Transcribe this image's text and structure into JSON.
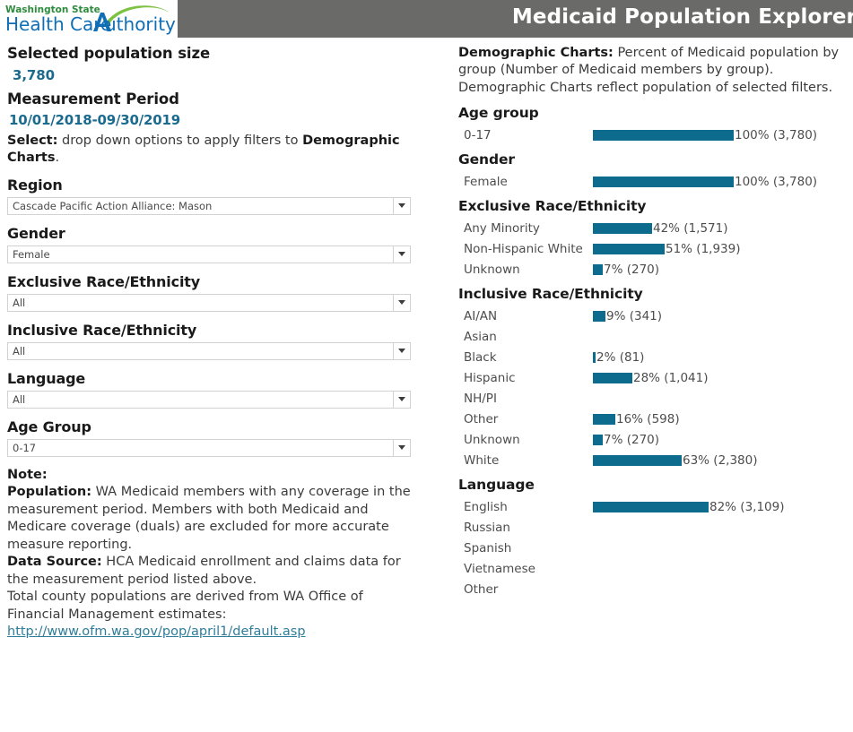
{
  "header": {
    "logo": {
      "line1": "Washington State",
      "line2a": "Health Care ",
      "line2b": "Authority",
      "blue": "#0f6eb5",
      "green": "#7dc242"
    },
    "title": "Medicaid Population Explorer",
    "bar_color": "#6a6a68"
  },
  "left": {
    "population_label": "Selected population size",
    "population_value": "3,780",
    "period_label": "Measurement Period",
    "period_value": "10/01/2018-09/30/2019",
    "select_note_bold1": "Select:",
    "select_note_mid": " drop down options to apply filters to ",
    "select_note_bold2": "Demographic Charts",
    "select_note_end": ".",
    "filters": [
      {
        "label": "Region",
        "value": "Cascade Pacific Action Alliance: Mason",
        "icon": "chevron-down-icon"
      },
      {
        "label": "Gender",
        "value": "Female",
        "icon": "chevron-down-icon"
      },
      {
        "label": "Exclusive Race/Ethnicity",
        "value": "All",
        "icon": "chevron-down-icon"
      },
      {
        "label": "Inclusive Race/Ethnicity",
        "value": "All",
        "icon": "chevron-down-icon"
      },
      {
        "label": "Language",
        "value": "All",
        "icon": "chevron-down-icon"
      },
      {
        "label": "Age Group",
        "value": "0-17",
        "icon": "chevron-down-icon"
      }
    ],
    "note": {
      "heading": "Note:",
      "population_bold": "Population:",
      "population_text": " WA Medicaid members with any coverage in the measurement period. Members with both Medicaid and Medicare coverage (duals) are excluded for more accurate measure reporting.",
      "source_bold": "Data Source:",
      "source_text": " HCA Medicaid enrollment and claims data for the measurement period listed above.",
      "ofm_text": "Total county populations are derived from WA Office of Financial Management estimates:",
      "link": "http://www.ofm.wa.gov/pop/april1/default.asp",
      "link_color": "#2e7d9a"
    }
  },
  "right": {
    "desc_bold": "Demographic Charts:",
    "desc_text": " Percent of Medicaid population by group (Number of Medicaid members by group).",
    "desc_line2": "Demographic Charts reflect population of selected filters."
  },
  "chart_data": [
    {
      "type": "bar",
      "title": "Age group",
      "orientation": "horizontal",
      "xlabel": "Percent of Medicaid population",
      "ylabel": "",
      "xlim": [
        0,
        100
      ],
      "grid": false,
      "legend": null,
      "bar_color": "#0d6c8e",
      "categories": [
        "0-17"
      ],
      "values": [
        100
      ],
      "counts": [
        3780
      ],
      "labels": [
        "100% (3,780)"
      ]
    },
    {
      "type": "bar",
      "title": "Gender",
      "orientation": "horizontal",
      "xlabel": "Percent of Medicaid population",
      "ylabel": "",
      "xlim": [
        0,
        100
      ],
      "grid": false,
      "legend": null,
      "bar_color": "#0d6c8e",
      "categories": [
        "Female"
      ],
      "values": [
        100
      ],
      "counts": [
        3780
      ],
      "labels": [
        "100% (3,780)"
      ]
    },
    {
      "type": "bar",
      "title": "Exclusive Race/Ethnicity",
      "orientation": "horizontal",
      "xlabel": "Percent of Medicaid population",
      "ylabel": "",
      "xlim": [
        0,
        100
      ],
      "grid": false,
      "legend": null,
      "bar_color": "#0d6c8e",
      "categories": [
        "Any Minority",
        "Non-Hispanic White",
        "Unknown"
      ],
      "values": [
        42,
        51,
        7
      ],
      "counts": [
        1571,
        1939,
        270
      ],
      "labels": [
        "42% (1,571)",
        "51% (1,939)",
        "7% (270)"
      ]
    },
    {
      "type": "bar",
      "title": "Inclusive Race/Ethnicity",
      "orientation": "horizontal",
      "xlabel": "Percent of Medicaid population",
      "ylabel": "",
      "xlim": [
        0,
        100
      ],
      "grid": false,
      "legend": null,
      "bar_color": "#0d6c8e",
      "categories": [
        "AI/AN",
        "Asian",
        "Black",
        "Hispanic",
        "NH/PI",
        "Other",
        "Unknown",
        "White"
      ],
      "values": [
        9,
        null,
        2,
        28,
        null,
        16,
        7,
        63
      ],
      "counts": [
        341,
        null,
        81,
        1041,
        null,
        598,
        270,
        2380
      ],
      "labels": [
        "9% (341)",
        "",
        "2% (81)",
        "28% (1,041)",
        "",
        "16% (598)",
        "7% (270)",
        "63% (2,380)"
      ]
    },
    {
      "type": "bar",
      "title": "Language",
      "orientation": "horizontal",
      "xlabel": "Percent of Medicaid population",
      "ylabel": "",
      "xlim": [
        0,
        100
      ],
      "grid": false,
      "legend": null,
      "bar_color": "#0d6c8e",
      "categories": [
        "English",
        "Russian",
        "Spanish",
        "Vietnamese",
        "Other"
      ],
      "values": [
        82,
        null,
        null,
        null,
        null
      ],
      "counts": [
        3109,
        null,
        null,
        null,
        null
      ],
      "labels": [
        "82% (3,109)",
        "",
        "",
        "",
        ""
      ]
    }
  ]
}
